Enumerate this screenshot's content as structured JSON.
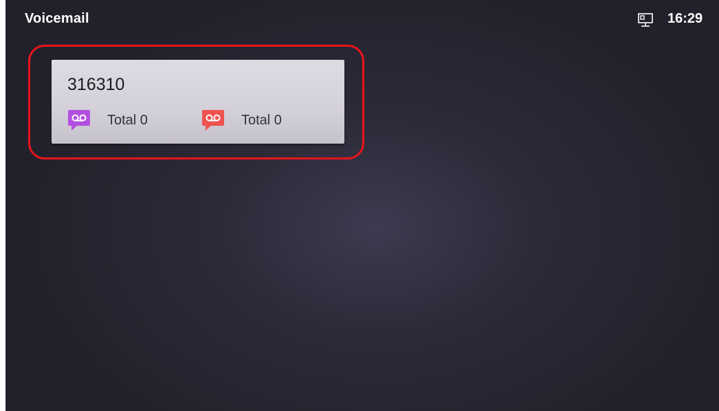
{
  "statusbar": {
    "title": "Voicemail",
    "network_icon": "ethernet-icon",
    "time": "16:29"
  },
  "voicemail_account": {
    "number": "316310",
    "stats": [
      {
        "icon": "voicemail-purple-icon",
        "color": "#b150e0",
        "label": "Total 0"
      },
      {
        "icon": "voicemail-red-icon",
        "color": "#ef5350",
        "label": "Total 0"
      }
    ]
  },
  "colors": {
    "highlight": "#e8141b",
    "background": "#2c2a38"
  }
}
